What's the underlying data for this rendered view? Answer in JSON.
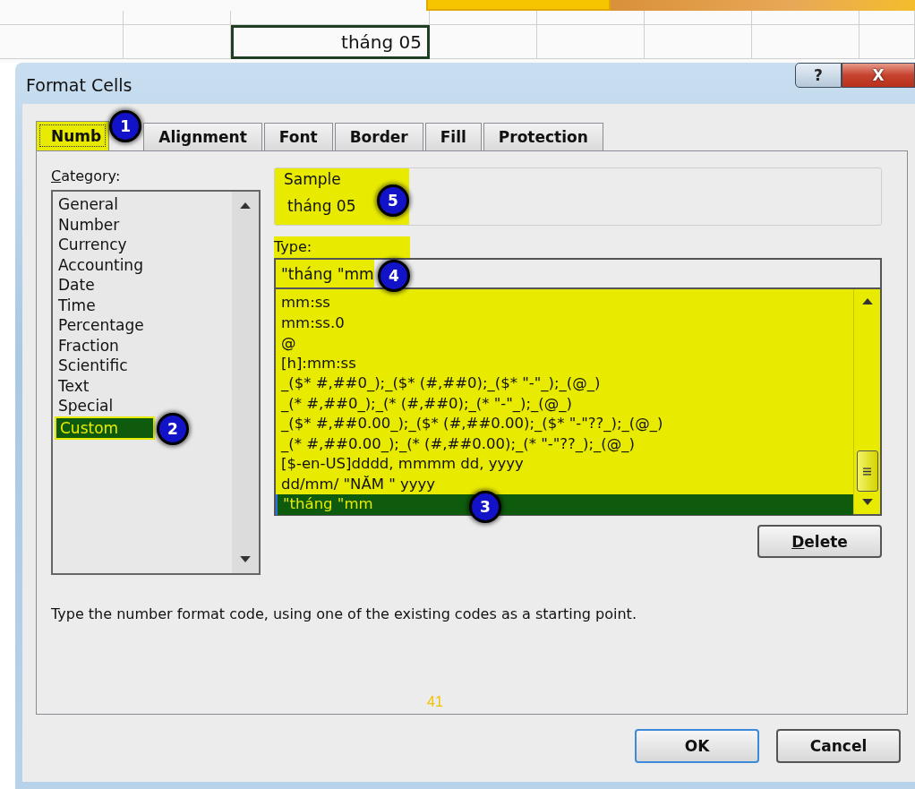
{
  "spreadsheet": {
    "active_cell": "tháng 05"
  },
  "slide": {
    "page_number": "41"
  },
  "window": {
    "title": "Format Cells",
    "help_button": "?",
    "close_button": "X"
  },
  "tabs": [
    {
      "label": "Numb",
      "selected": true,
      "badge": "1"
    },
    {
      "label": "Alignment",
      "selected": false
    },
    {
      "label": "Font",
      "selected": false
    },
    {
      "label": "Border",
      "selected": false
    },
    {
      "label": "Fill",
      "selected": false
    },
    {
      "label": "Protection",
      "selected": false
    }
  ],
  "category": {
    "label": "Category:",
    "items": [
      {
        "label": "General",
        "selected": false
      },
      {
        "label": "Number",
        "selected": false
      },
      {
        "label": "Currency",
        "selected": false
      },
      {
        "label": "Accounting",
        "selected": false
      },
      {
        "label": "Date",
        "selected": false
      },
      {
        "label": "Time",
        "selected": false
      },
      {
        "label": "Percentage",
        "selected": false
      },
      {
        "label": "Fraction",
        "selected": false
      },
      {
        "label": "Scientific",
        "selected": false
      },
      {
        "label": "Text",
        "selected": false
      },
      {
        "label": "Special",
        "selected": false
      },
      {
        "label": "Custom",
        "selected": true,
        "badge": "2"
      }
    ]
  },
  "sample": {
    "label": "Sample",
    "value": "tháng 05",
    "badge": "5"
  },
  "type": {
    "label": "Type:",
    "value": "\"tháng \"mm",
    "badge": "4",
    "items": [
      {
        "label": "mm:ss",
        "selected": false
      },
      {
        "label": "mm:ss.0",
        "selected": false
      },
      {
        "label": "@",
        "selected": false
      },
      {
        "label": "[h]:mm:ss",
        "selected": false
      },
      {
        "label": "_($* #,##0_);_($* (#,##0);_($* \"-\"_);_(@_)",
        "selected": false
      },
      {
        "label": "_(* #,##0_);_(* (#,##0);_(* \"-\"_);_(@_)",
        "selected": false
      },
      {
        "label": "_($* #,##0.00_);_($* (#,##0.00);_($* \"-\"??_);_(@_)",
        "selected": false
      },
      {
        "label": "_(* #,##0.00_);_(* (#,##0.00);_(* \"-\"??_);_(@_)",
        "selected": false
      },
      {
        "label": "[$-en-US]dddd, mmmm dd, yyyy",
        "selected": false
      },
      {
        "label": "dd/mm/ \"NĂM \" yyyy",
        "selected": false
      },
      {
        "label": "\"tháng \"mm",
        "selected": true,
        "badge": "3"
      }
    ]
  },
  "delete_button": "Delete",
  "description": "Type the number format code, using one of the existing codes as a starting point.",
  "buttons": [
    {
      "label": "OK",
      "default": true
    },
    {
      "label": "Cancel",
      "default": false
    }
  ]
}
